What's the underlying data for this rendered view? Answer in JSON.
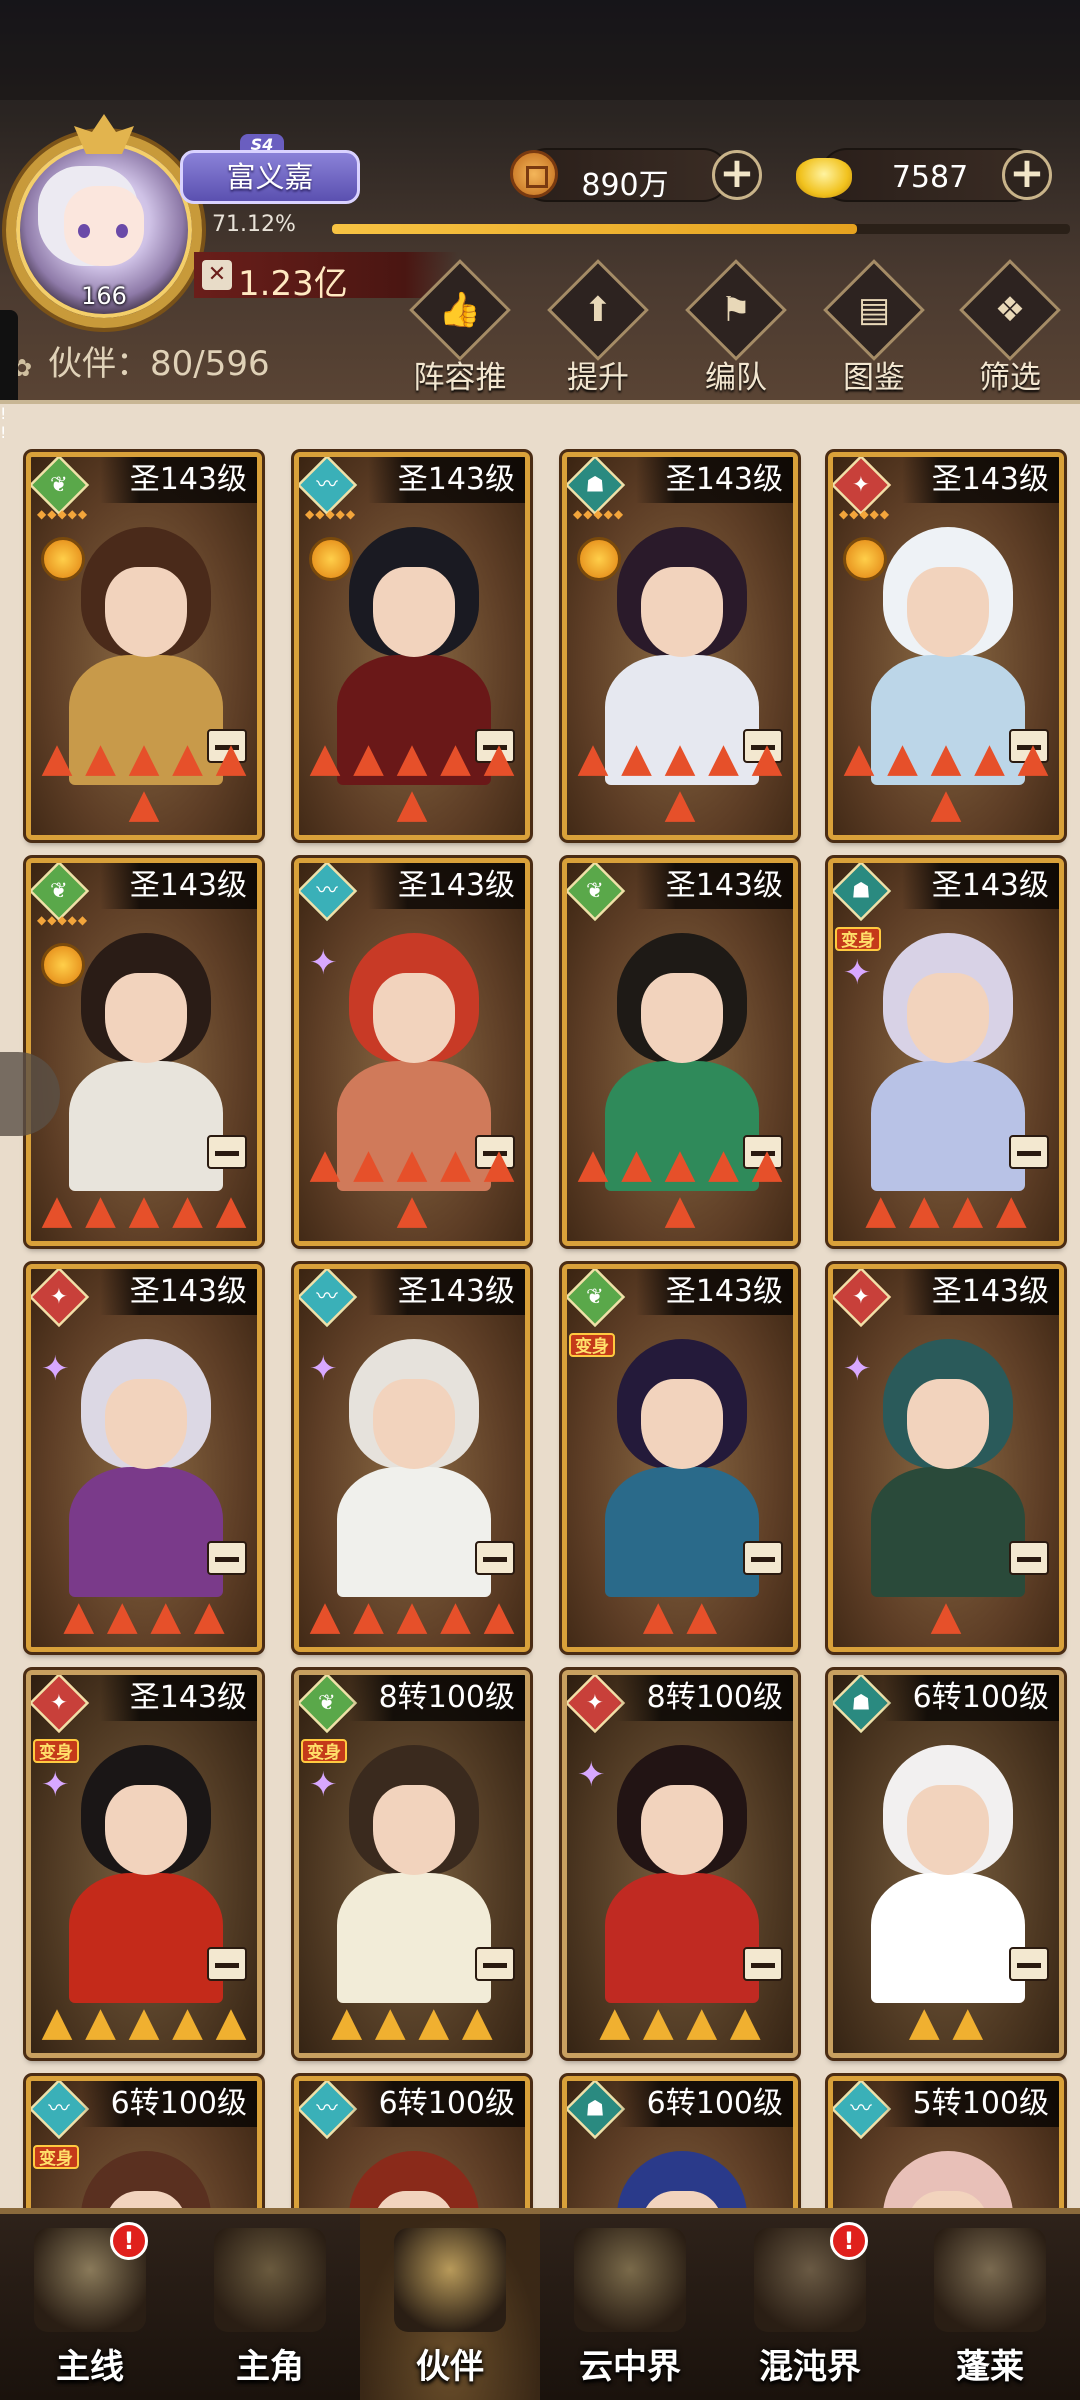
{
  "player": {
    "name": "富义嘉",
    "season": "S4",
    "level": "166",
    "exp_percent": "71.12%",
    "exp_fraction": 0.7112,
    "power": "1.23亿"
  },
  "currency": {
    "coins": "890万",
    "ingots": "7587"
  },
  "partner_count": "伙伴：80/596",
  "menu": [
    {
      "label": "阵容推荐",
      "icon": "recommend-icon"
    },
    {
      "label": "提升",
      "icon": "upgrade-icon"
    },
    {
      "label": "编队",
      "icon": "formation-icon"
    },
    {
      "label": "图鉴",
      "icon": "codex-icon"
    },
    {
      "label": "筛选",
      "icon": "filter-icon"
    }
  ],
  "cards": [
    {
      "level": "圣143级",
      "faction": "wind",
      "flames": 6,
      "alert": true,
      "medal": true,
      "pips": true
    },
    {
      "level": "圣143级",
      "faction": "water",
      "flames": 6,
      "alert": false,
      "medal": true,
      "pips": true
    },
    {
      "level": "圣143级",
      "faction": "ghost",
      "flames": 6,
      "alert": false,
      "medal": true,
      "pips": true
    },
    {
      "level": "圣143级",
      "faction": "fox",
      "flames": 6,
      "alert": true,
      "medal": true,
      "pips": true
    },
    {
      "level": "圣143级",
      "faction": "wind",
      "flames": 5,
      "alert": false,
      "medal": true,
      "pips": true
    },
    {
      "level": "圣143级",
      "faction": "water",
      "flames": 6,
      "alert": false,
      "spark": true
    },
    {
      "level": "圣143级",
      "faction": "wind",
      "flames": 6,
      "alert": false
    },
    {
      "level": "圣143级",
      "faction": "ghost",
      "flames": 4,
      "alert": false,
      "transform": "变身",
      "spark": true
    },
    {
      "level": "圣143级",
      "faction": "fox",
      "flames": 4,
      "alert": false,
      "spark": true
    },
    {
      "level": "圣143级",
      "faction": "water",
      "flames": 5,
      "alert": false,
      "spark": true
    },
    {
      "level": "圣143级",
      "faction": "wind",
      "flames": 2,
      "alert": false,
      "transform": "变身"
    },
    {
      "level": "圣143级",
      "faction": "fox",
      "flames": 1,
      "alert": false,
      "spark": true
    },
    {
      "level": "圣143级",
      "faction": "fox",
      "flames": 5,
      "alert": false,
      "transform": "变身",
      "spark": true,
      "gold": true
    },
    {
      "level": "8转100级",
      "faction": "wind",
      "flames": 4,
      "alert": false,
      "transform": "变身",
      "spark": true,
      "gold": true
    },
    {
      "level": "8转100级",
      "faction": "fox",
      "flames": 4,
      "alert": false,
      "spark": true,
      "gold": true
    },
    {
      "level": "6转100级",
      "faction": "ghost",
      "flames": 2,
      "alert": false,
      "gold": true
    },
    {
      "level": "6转100级",
      "faction": "water",
      "flames": 0,
      "alert": false,
      "transform": "变身"
    },
    {
      "level": "6转100级",
      "faction": "water",
      "flames": 0,
      "alert": false
    },
    {
      "level": "6转100级",
      "faction": "ghost",
      "flames": 0,
      "alert": false
    },
    {
      "level": "5转100级",
      "faction": "water",
      "flames": 0,
      "alert": false
    }
  ],
  "nav": [
    {
      "label": "主线",
      "icon": "swords-icon",
      "alert": true
    },
    {
      "label": "主角",
      "icon": "hero-icon",
      "alert": false
    },
    {
      "label": "伙伴",
      "icon": "partner-icon",
      "alert": false,
      "active": true
    },
    {
      "label": "云中界",
      "icon": "cloud-palace-icon",
      "alert": false
    },
    {
      "label": "混沌界",
      "icon": "chaos-icon",
      "alert": true
    },
    {
      "label": "蓬莱",
      "icon": "penglai-icon",
      "alert": false
    }
  ],
  "colors": {
    "wind": "#5aa84a",
    "water": "#3ab0b8",
    "ghost": "#2a8a80",
    "fox": "#c8403a",
    "flame_red": "#e6502a",
    "flame_gold": "#f0b030"
  }
}
